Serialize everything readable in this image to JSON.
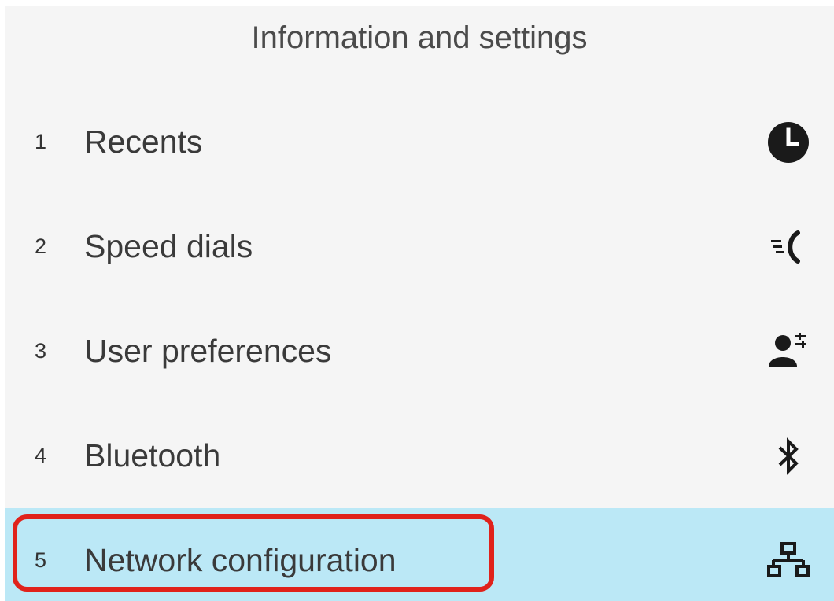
{
  "header": {
    "title": "Information and settings"
  },
  "menu": {
    "items": [
      {
        "number": "1",
        "label": "Recents",
        "icon": "clock-icon"
      },
      {
        "number": "2",
        "label": "Speed dials",
        "icon": "speed-dial-icon"
      },
      {
        "number": "3",
        "label": "User preferences",
        "icon": "user-preferences-icon"
      },
      {
        "number": "4",
        "label": "Bluetooth",
        "icon": "bluetooth-icon"
      },
      {
        "number": "5",
        "label": "Network configuration",
        "icon": "network-icon",
        "selected": true
      }
    ]
  },
  "colors": {
    "selected_background": "#bbe8f6",
    "highlight_border": "#e0221b",
    "screen_background": "#f5f5f5"
  }
}
